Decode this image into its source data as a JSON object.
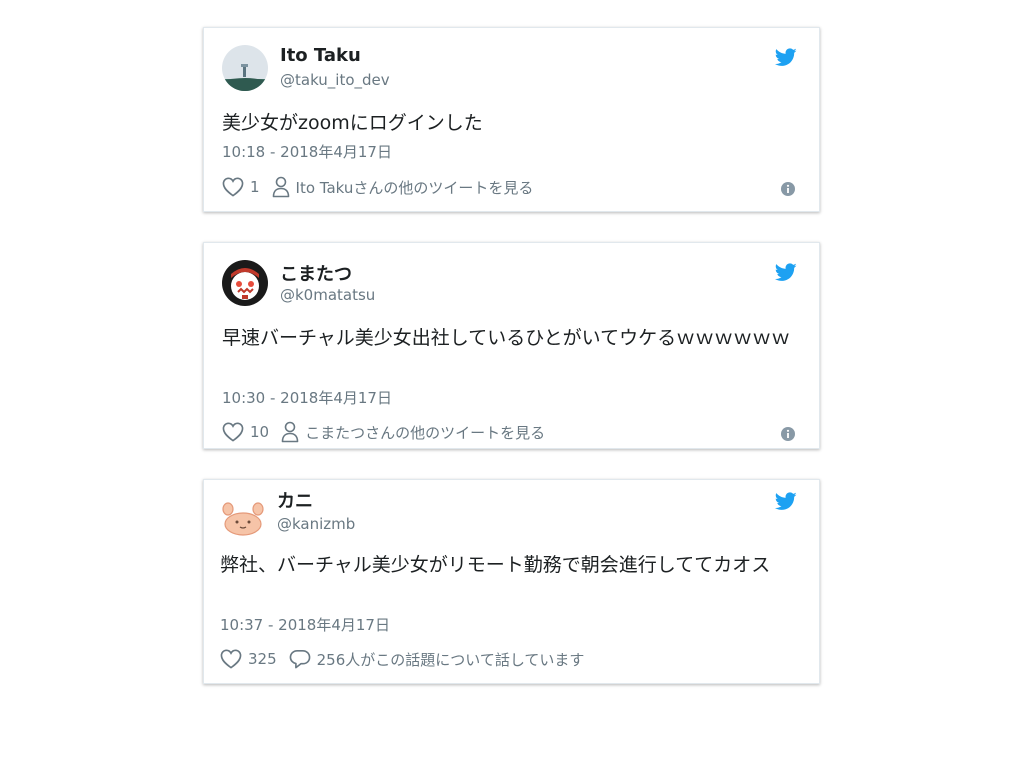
{
  "colors": {
    "twitter_blue": "#1da1f2",
    "text": "#1c2022",
    "secondary": "#697882",
    "border": "#e1e8ed"
  },
  "tweets": [
    {
      "name": "Ito Taku",
      "handle": "@taku_ito_dev",
      "text": "美少女がzoomにログインした",
      "time": "10:18 - 2018年4月17日",
      "likes": "1",
      "secondary_icon": "person-icon",
      "secondary_label": "Ito Takuさんの他のツイートを見る",
      "avatar_icon": "landscape-avatar"
    },
    {
      "name": "こまたつ",
      "handle": "@k0matatsu",
      "text": "早速バーチャル美少女出社しているひとがいてウケるｗｗｗｗｗｗ",
      "time": "10:30 - 2018年4月17日",
      "likes": "10",
      "secondary_icon": "person-icon",
      "secondary_label": "こまたつさんの他のツイートを見る",
      "avatar_icon": "character-avatar"
    },
    {
      "name": "カニ",
      "handle": "@kanizmb",
      "text": "弊社、バーチャル美少女がリモート勤務で朝会進行しててカオス",
      "time": "10:37 - 2018年4月17日",
      "likes": "325",
      "secondary_icon": "reply-icon",
      "secondary_label": "256人がこの話題について話しています",
      "avatar_icon": "crab-avatar"
    }
  ]
}
